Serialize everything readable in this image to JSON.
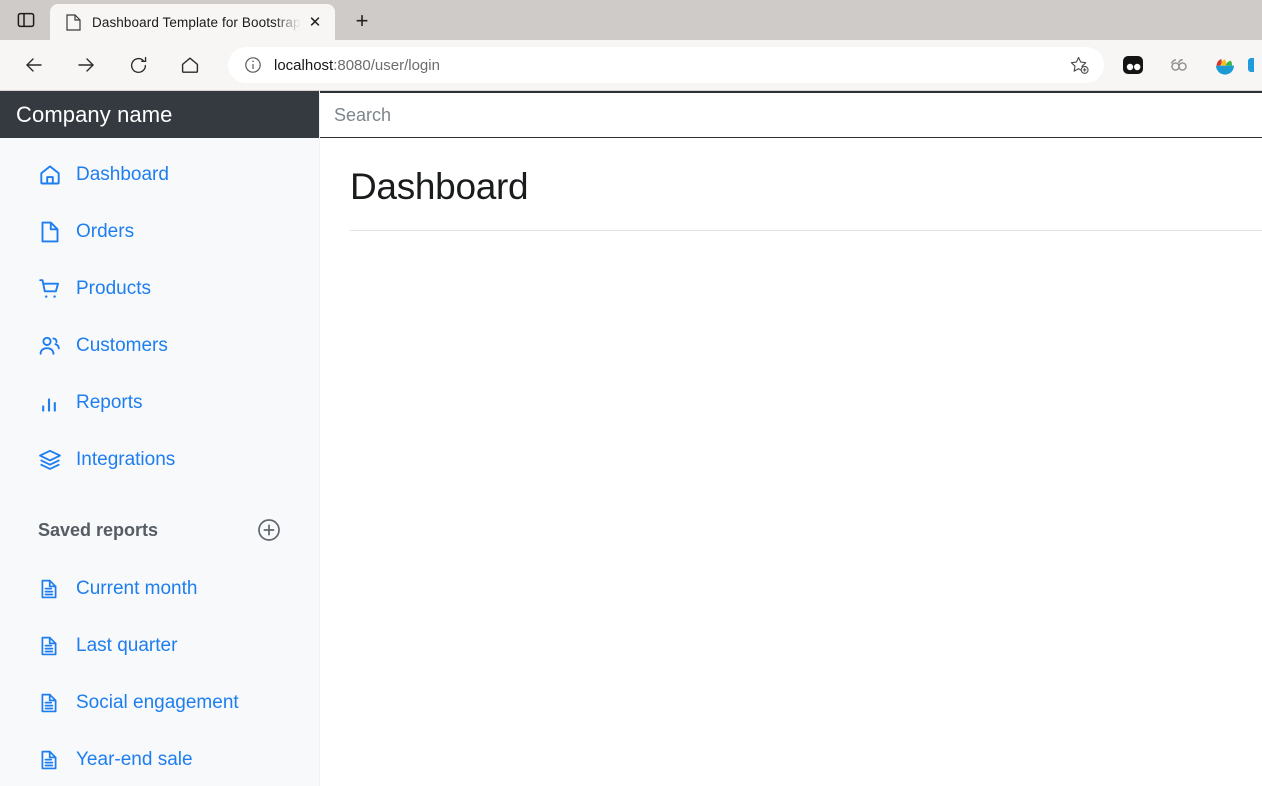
{
  "browser": {
    "tab_list_icon": "tab-list-icon",
    "tab": {
      "favicon": "page-favicon",
      "title": "Dashboard Template for Bootstrap",
      "close_label": "✕"
    },
    "new_tab_label": "+",
    "nav": {
      "back": "back-arrow-icon",
      "forward": "forward-arrow-icon",
      "reload": "reload-icon",
      "home": "home-icon"
    },
    "omnibox": {
      "info_icon": "site-info-icon",
      "url_host": "localhost",
      "url_path": ":8080/user/login",
      "favorite_icon": "add-favorite-star-icon"
    },
    "extensions": [
      {
        "name": "extension-dark-icon"
      },
      {
        "name": "extension-rings-icon"
      },
      {
        "name": "extension-colorful-bowl-icon"
      }
    ]
  },
  "sidebar": {
    "brand": "Company name",
    "nav_items": [
      {
        "icon": "house-icon",
        "label": "Dashboard"
      },
      {
        "icon": "file-icon",
        "label": "Orders"
      },
      {
        "icon": "shopping-cart-icon",
        "label": "Products"
      },
      {
        "icon": "people-icon",
        "label": "Customers"
      },
      {
        "icon": "bar-chart-icon",
        "label": "Reports"
      },
      {
        "icon": "layers-icon",
        "label": "Integrations"
      }
    ],
    "saved_reports": {
      "title": "Saved reports",
      "add_icon": "plus-circle-icon",
      "items": [
        {
          "icon": "file-text-icon",
          "label": "Current month"
        },
        {
          "icon": "file-text-icon",
          "label": "Last quarter"
        },
        {
          "icon": "file-text-icon",
          "label": "Social engagement"
        },
        {
          "icon": "file-text-icon",
          "label": "Year-end sale"
        }
      ]
    }
  },
  "content": {
    "search_placeholder": "Search",
    "search_value": "",
    "page_title": "Dashboard"
  },
  "colors": {
    "sidebar_bg": "#f8f9fa",
    "brand_bg": "#343a40",
    "link_blue": "#1e7ef0",
    "muted_gray": "#555c63"
  }
}
